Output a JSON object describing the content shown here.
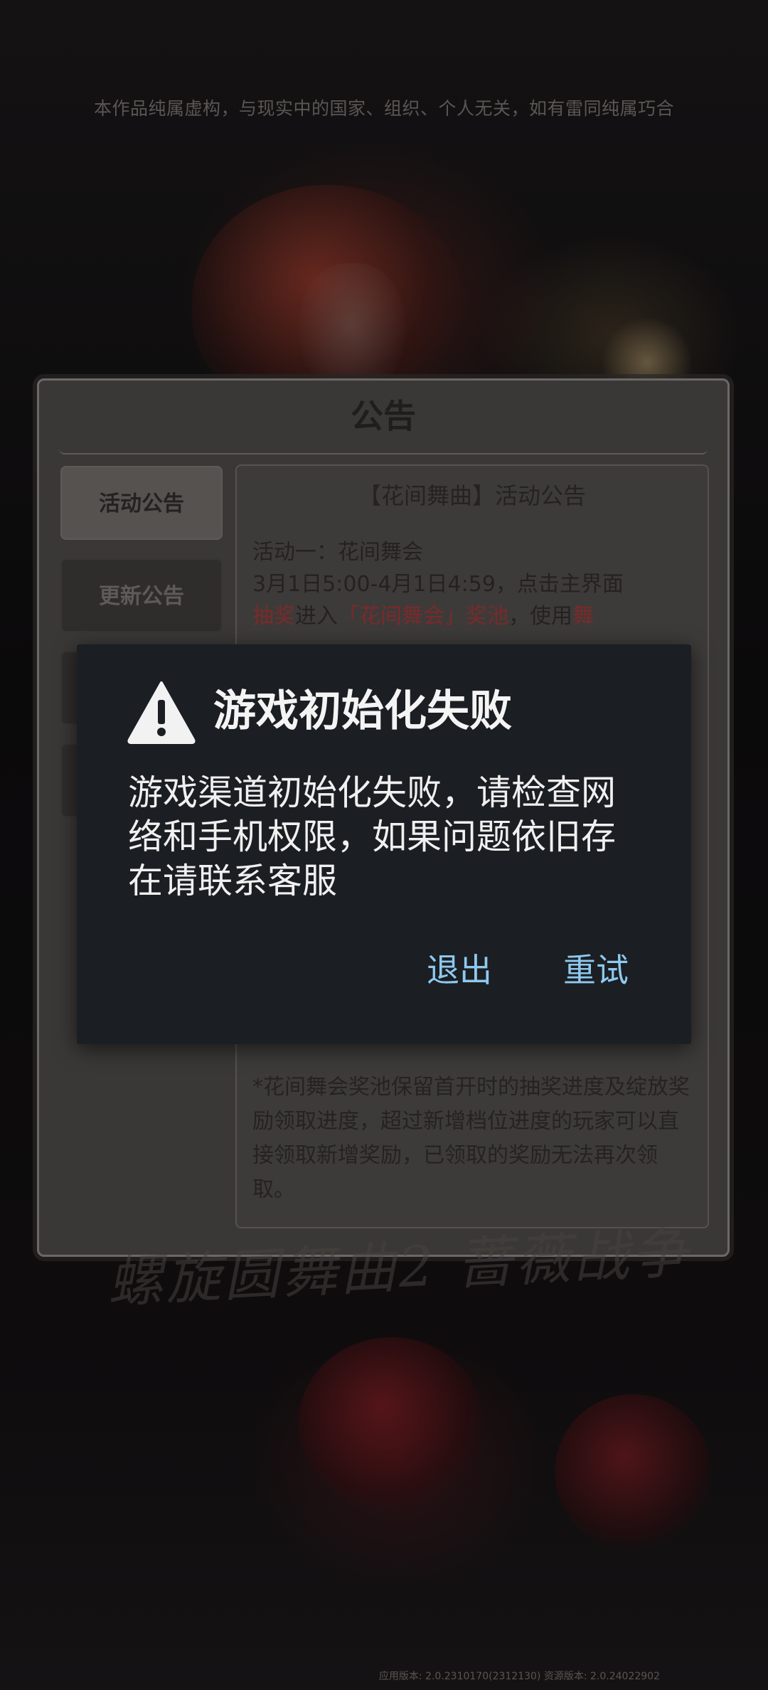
{
  "disclaimer": "本作品纯属虚构，与现实中的国家、组织、个人无关，如有雷同纯属巧合",
  "notice": {
    "title": "公告",
    "tabs": [
      {
        "label": "活动公告",
        "active": true
      },
      {
        "label": "更新公告",
        "active": false
      }
    ],
    "content": {
      "heading": "【花间舞曲】活动公告",
      "line1": "活动一：花间舞会",
      "line2": "3月1日5:00-4月1日4:59，点击主界面",
      "line3_part1": "抽奖",
      "line3_part2": "进入",
      "line3_part3": "「花间舞会」奖池",
      "line3_part4": "，使用",
      "line3_part5": "舞",
      "note": "*花间舞会奖池保留首开时的抽奖进度及绽放奖励领取进度，超过新增档位进度的玩家可以直接领取新增奖励，已领取的奖励无法再次领取。"
    }
  },
  "logo_text": "螺旋圆舞曲2 蔷薇战争",
  "version": "应用版本: 2.0.2310170(2312130) 资源版本: 2.0.24022902",
  "dialog": {
    "title": "游戏初始化失败",
    "message": "游戏渠道初始化失败，请检查网络和手机权限，如果问题依旧存在请联系客服",
    "exit_label": "退出",
    "retry_label": "重试",
    "icon": "warning-triangle-icon"
  },
  "colors": {
    "dialog_bg": "#1b1e22",
    "dialog_button": "#8ec9ef",
    "highlight_red": "#7a2a2a"
  }
}
